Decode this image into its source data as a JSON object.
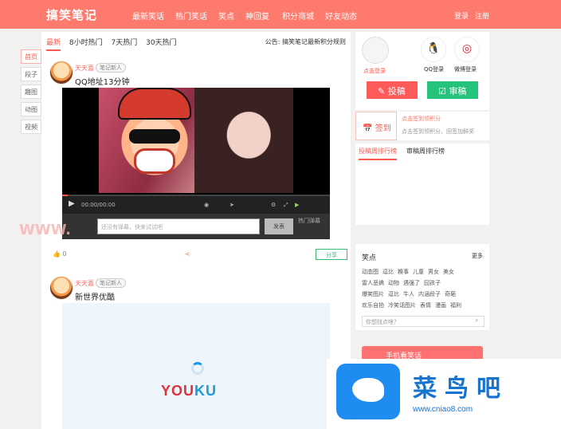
{
  "header": {
    "logo": "搞笑笔记",
    "nav": [
      "最新笑话",
      "热门笑话",
      "笑点",
      "神回复",
      "积分商城",
      "好友动态"
    ],
    "login": "登录",
    "register": "注册"
  },
  "rail": [
    "首页",
    "段子",
    "趣图",
    "动图",
    "视频"
  ],
  "main": {
    "tabs": [
      "最新",
      "8小时热门",
      "7天热门",
      "30天热门"
    ],
    "notice": "公告: 搞笑笔记最新积分规则",
    "posts": [
      {
        "user": "天天喜",
        "badge": "笔记新人",
        "title": "QQ地址13分钟",
        "time": "00:00/00:00",
        "danmaku_placeholder": "还没有弹幕，快来试试吧",
        "send": "发表",
        "hot": "热门弹幕",
        "likes": "0"
      },
      {
        "user": "天天喜",
        "badge": "笔记新人",
        "title": "新世界优酷"
      }
    ],
    "share_label": "分享",
    "youku": "YOUKU"
  },
  "side": {
    "login_link": "点击登录",
    "qq_label": "QQ登录",
    "weibo_label": "微博登录",
    "post_btn": "投稿",
    "review_btn": "审稿",
    "sign_btn": "签到",
    "sign_tip1": "点击签到领积分",
    "sign_tip2": "点击签到领积分，回签加鲜奖",
    "rank_tabs": [
      "投稿周排行榜",
      "审稿周排行榜"
    ],
    "tags_title": "笑点",
    "tags_more": "更多",
    "tag_rows": [
      [
        "动态图",
        "逗比",
        "糗事",
        "儿童",
        "男女",
        "美女"
      ],
      [
        "雷人恶搞",
        "动物",
        "遇强了",
        "囧孩子"
      ],
      [
        "爆笑图片",
        "逗比",
        "牛人",
        "内涵段子",
        "奇葩"
      ],
      [
        "欢乐自拍",
        "冷笑话图片",
        "表情",
        "漫画",
        "福利"
      ]
    ],
    "search_placeholder": "你想找点啥？",
    "mobile": "手机看笑话"
  },
  "ad": {
    "name": "菜鸟吧",
    "url": "www.cniao8.com"
  },
  "colors": {
    "accent": "#ff7a6e",
    "green": "#25c27c",
    "red": "#ff5a5a"
  }
}
